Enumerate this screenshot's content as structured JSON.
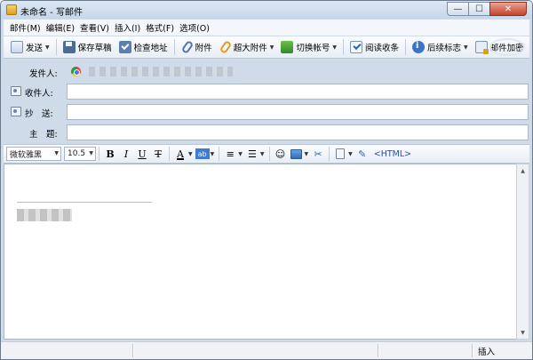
{
  "window": {
    "title": "未命名 - 写邮件",
    "minimize_glyph": "—",
    "maximize_glyph": "☐",
    "close_glyph": "✕"
  },
  "menu": [
    {
      "label": "邮件(M)"
    },
    {
      "label": "编辑(E)"
    },
    {
      "label": "查看(V)"
    },
    {
      "label": "插入(I)"
    },
    {
      "label": "格式(F)"
    },
    {
      "label": "选项(O)"
    }
  ],
  "toolbar": {
    "send": "发送",
    "save_draft": "保存草稿",
    "check_address": "检查地址",
    "attachment": "附件",
    "big_attachment": "超大附件",
    "switch_account": "切换帐号",
    "read_receipt": "阅读收条",
    "follow_up": "后续标志",
    "encrypt": "邮件加密"
  },
  "fields": {
    "from_label": "发件人:",
    "to_label": "收件人:",
    "cc_label": "抄　送:",
    "subject_label": "主　题:",
    "to_value": "",
    "cc_value": "",
    "subject_value": ""
  },
  "format": {
    "font_name": "微软雅黑",
    "font_size": "10.5",
    "bold": "B",
    "italic": "I",
    "underline": "U",
    "strike": "T",
    "font_color": "A",
    "highlight": "ab",
    "emoji": "☺",
    "html": "<HTML>"
  },
  "status": {
    "mode": "插入"
  },
  "colors": {
    "window_bg": "#cfdbe9",
    "link": "#2a4fa8"
  }
}
